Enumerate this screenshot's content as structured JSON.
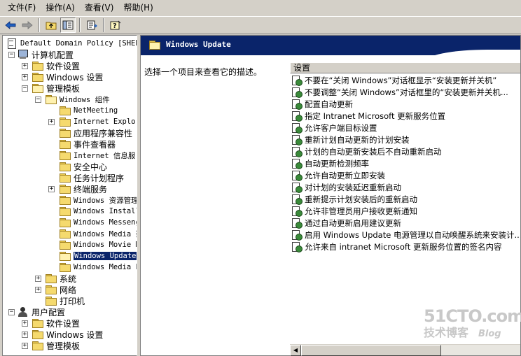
{
  "menu": {
    "items": [
      "文件(F)",
      "操作(A)",
      "查看(V)",
      "帮助(H)"
    ]
  },
  "toolbar": {
    "buttons": [
      "back-icon",
      "forward-icon",
      "up-folder-icon",
      "show-hide-tree-icon",
      "export-list-icon",
      "help-icon"
    ]
  },
  "tree": {
    "root": "Default Domain Policy [SHENY",
    "computer_config": "计算机配置",
    "software_settings": "软件设置",
    "windows_settings": "Windows 设置",
    "admin_templates": "管理模板",
    "windows_components": "Windows 组件",
    "netmeeting": "NetMeeting",
    "internet_explorer": "Internet Explor",
    "app_compat": "应用程序兼容性",
    "event_viewer": "事件查看器",
    "iis": "Internet 信息服",
    "security_center": "安全中心",
    "task_scheduler": "任务计划程序",
    "terminal_services": "终端服务",
    "windows_explorer": "Windows 资源管理",
    "windows_installer": "Windows Install",
    "windows_messenger": "Windows Messeng",
    "windows_media_dm": "Windows Media 数",
    "windows_movie_maker": "Windows Movie M",
    "windows_update": "Windows Update",
    "windows_media_player": "Windows Media P",
    "system": "系统",
    "network": "网络",
    "printers": "打印机",
    "user_config": "用户配置",
    "user_software_settings": "软件设置",
    "user_windows_settings": "Windows 设置",
    "user_admin_templates": "管理模板"
  },
  "detail": {
    "title": "Windows Update",
    "description": "选择一个项目来查看它的描述。",
    "column_header": "设置",
    "settings": [
      "不要在“关闭 Windows”对话框显示“安装更新并关机”",
      "不要调整“关闭 Windows”对话框里的“安装更新并关机...",
      "配置自动更新",
      "指定 Intranet Microsoft 更新服务位置",
      "允许客户端目标设置",
      "重新计划自动更新的计划安装",
      "计划的自动更新安装后不自动重新启动",
      "自动更新检测频率",
      "允许自动更新立即安装",
      "对计划的安装延迟重新启动",
      "重新提示计划安装后的重新启动",
      "允许非管理员用户接收更新通知",
      "通过自动更新启用建议更新",
      "启用 Windows Update 电源管理以自动唤醒系统来安装计...",
      "允许来自 intranet Microsoft 更新服务位置的签名内容"
    ]
  },
  "watermark": {
    "main": "51CTO.com",
    "sub": "技术博客",
    "blog": "Blog"
  }
}
